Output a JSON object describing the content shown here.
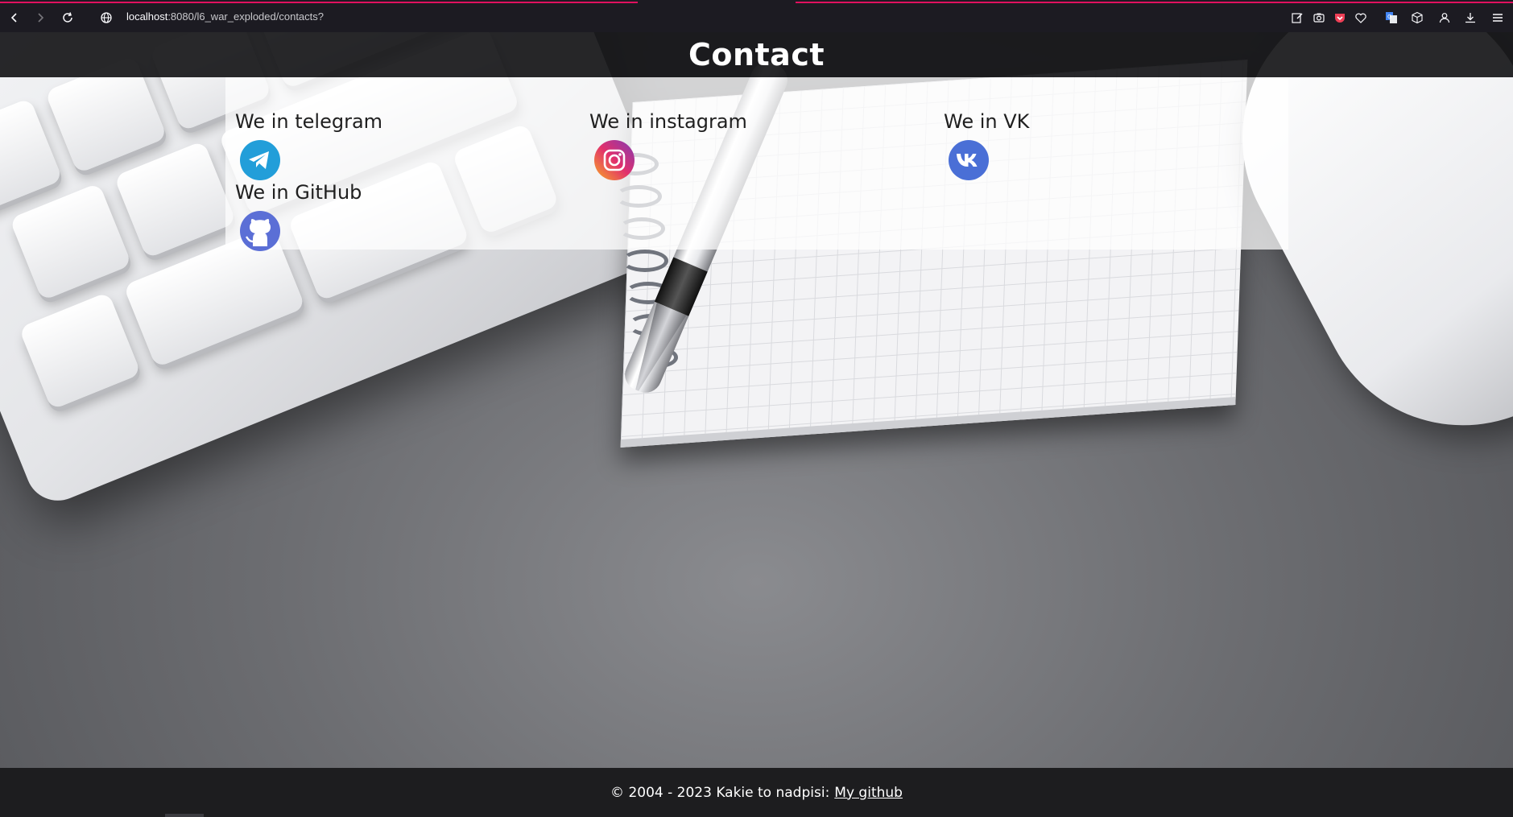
{
  "browser": {
    "url_host": "localhost",
    "url_path": ":8080/l6_war_exploded/contacts?"
  },
  "header": {
    "title": "Contact"
  },
  "contacts": [
    {
      "label": "We in telegram",
      "icon": "telegram-icon"
    },
    {
      "label": "We in instagram",
      "icon": "instagram-icon"
    },
    {
      "label": "We in VK",
      "icon": "vk-icon"
    },
    {
      "label": "We in GitHub",
      "icon": "github-icon"
    }
  ],
  "footer": {
    "text": "© 2004 - 2023 Kakie to nadpisi:",
    "link_label": "My github"
  },
  "colors": {
    "telegram": "#229ed9",
    "instagram_start": "#f9a825",
    "instagram_end": "#c13584",
    "vk": "#4a6fd6",
    "github": "#5b6fd6",
    "accent_loadbar": "#e0115f"
  }
}
